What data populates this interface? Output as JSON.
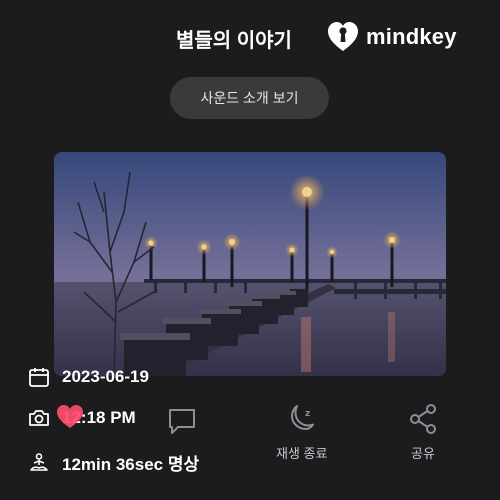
{
  "header": {
    "title": "별들의 이야기",
    "brand_name": "mindkey",
    "brand_icon": "mindkey-heart-keyhole-logo"
  },
  "sound_button": {
    "label": "사운드 소개 보기"
  },
  "photo": {
    "subject": "night-boardwalk-lamps-icon"
  },
  "meta": {
    "date": "2023-06-19",
    "time": "12:18 PM",
    "duration": "12min 36sec 명상",
    "date_icon": "calendar-icon",
    "time_icon": "camera-icon",
    "duration_icon": "meditation-icon"
  },
  "actions": {
    "like_icon": "heart-icon",
    "comment_icon": "comment-icon",
    "stop_label": "재생 종료",
    "stop_icon": "moon-sleep-icon",
    "share_label": "공유",
    "share_icon": "share-icon"
  },
  "colors": {
    "background": "#1c1c1e",
    "button_bg": "#3a3a3c",
    "heart": "#ff4d6d",
    "icon_grey": "#8e8e93"
  }
}
